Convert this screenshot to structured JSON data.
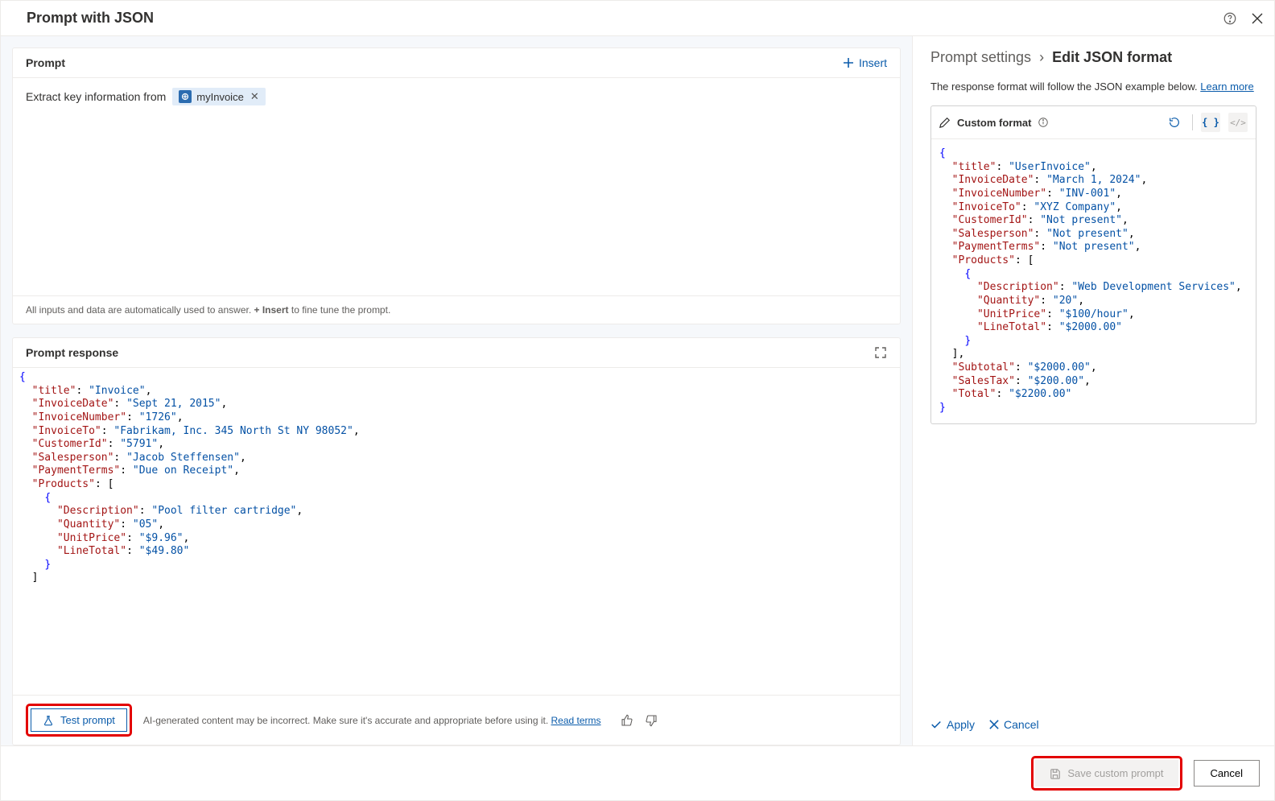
{
  "header": {
    "title": "Prompt with JSON"
  },
  "prompt_panel": {
    "title": "Prompt",
    "insert_label": "Insert",
    "prompt_text_prefix": "Extract key information from",
    "chip_label": "myInvoice",
    "footer_before": "All inputs and data are automatically used to answer. ",
    "footer_bold": "+ Insert",
    "footer_after": " to fine tune the prompt."
  },
  "response_panel": {
    "title": "Prompt response",
    "test_prompt_label": "Test prompt",
    "disclaimer_text": "AI-generated content may be incorrect. Make sure it's accurate and appropriate before using it. ",
    "read_terms_label": "Read terms",
    "json": {
      "title": "Invoice",
      "InvoiceDate": "Sept 21, 2015",
      "InvoiceNumber": "1726",
      "InvoiceTo": "Fabrikam, Inc. 345 North St NY 98052",
      "CustomerId": "5791",
      "Salesperson": "Jacob Steffensen",
      "PaymentTerms": "Due on Receipt",
      "Products": [
        {
          "Description": "Pool filter cartridge",
          "Quantity": "05",
          "UnitPrice": "$9.96",
          "LineTotal": "$49.80"
        }
      ]
    }
  },
  "right_panel": {
    "breadcrumb_parent": "Prompt settings",
    "breadcrumb_current": "Edit JSON format",
    "description_text": "The response format will follow the JSON example below. ",
    "learn_more_label": "Learn more",
    "format_label": "Custom format",
    "apply_label": "Apply",
    "cancel_label": "Cancel",
    "json": {
      "title": "UserInvoice",
      "InvoiceDate": "March 1, 2024",
      "InvoiceNumber": "INV-001",
      "InvoiceTo": "XYZ Company",
      "CustomerId": "Not present",
      "Salesperson": "Not present",
      "PaymentTerms": "Not present",
      "Products": [
        {
          "Description": "Web Development Services",
          "Quantity": "20",
          "UnitPrice": "$100/hour",
          "LineTotal": "$2000.00"
        }
      ],
      "Subtotal": "$2000.00",
      "SalesTax": "$200.00",
      "Total": "$2200.00"
    }
  },
  "footer": {
    "save_label": "Save custom prompt",
    "cancel_label": "Cancel"
  }
}
